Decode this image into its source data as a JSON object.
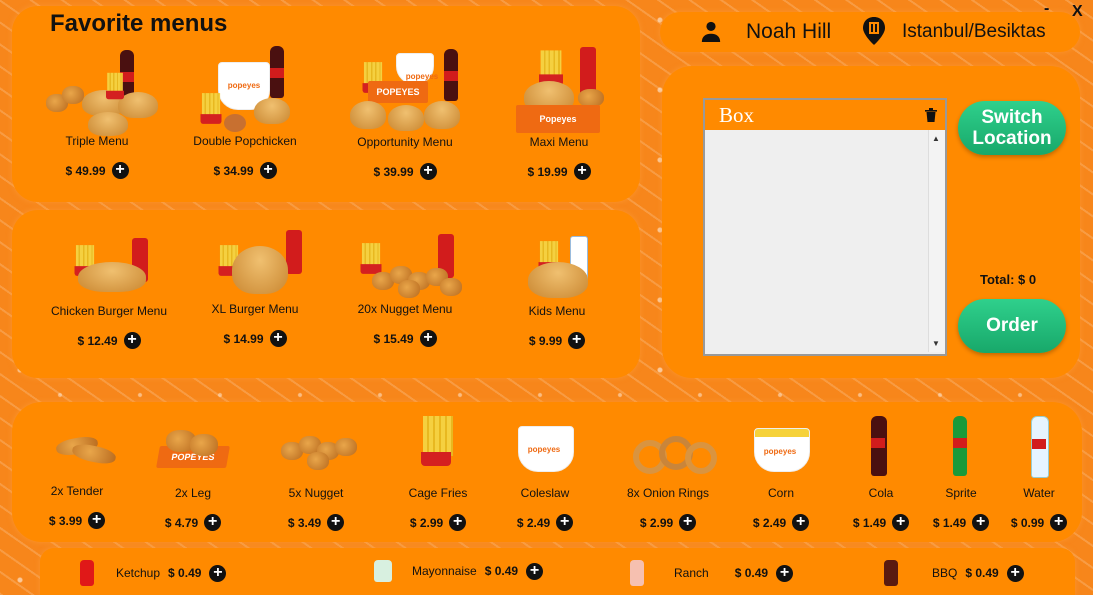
{
  "window": {
    "minimize_label": "-",
    "close_label": "X"
  },
  "favorites": {
    "title": "Favorite menus",
    "items": [
      {
        "name": "Triple Menu",
        "price": "$ 49.99"
      },
      {
        "name": "Double Popchicken",
        "price": "$ 34.99"
      },
      {
        "name": "Opportunity Menu",
        "price": "$ 39.99"
      },
      {
        "name": "Maxi Menu",
        "price": "$ 19.99"
      },
      {
        "name": "Chicken Burger Menu",
        "price": "$ 12.49"
      },
      {
        "name": "XL Burger Menu",
        "price": "$ 14.99"
      },
      {
        "name": "20x Nugget Menu",
        "price": "$ 15.49"
      },
      {
        "name": "Kids Menu",
        "price": "$ 9.99"
      }
    ]
  },
  "user": {
    "name": "Noah Hill",
    "location": "Istanbul/Besiktas"
  },
  "cart": {
    "header": "Box",
    "total_label": "Total: $ 0",
    "switch_label": "Switch Location",
    "order_label": "Order"
  },
  "sides": [
    {
      "name": "2x Tender",
      "price": "$ 3.99"
    },
    {
      "name": "2x Leg",
      "price": "$ 4.79"
    },
    {
      "name": "5x Nugget",
      "price": "$ 3.49"
    },
    {
      "name": "Cage Fries",
      "price": "$ 2.99"
    },
    {
      "name": "Coleslaw",
      "price": "$ 2.49"
    },
    {
      "name": "8x Onion Rings",
      "price": "$ 2.99"
    },
    {
      "name": "Corn",
      "price": "$ 2.49"
    },
    {
      "name": "Cola",
      "price": "$ 1.49"
    },
    {
      "name": "Sprite",
      "price": "$ 1.49"
    },
    {
      "name": "Water",
      "price": "$ 0.99"
    }
  ],
  "sauces": [
    {
      "name": "Ketchup",
      "price": "$ 0.49"
    },
    {
      "name": "Mayonnaise",
      "price": "$ 0.49"
    },
    {
      "name": "Ranch",
      "price": "$ 0.49"
    },
    {
      "name": "BBQ",
      "price": "$ 0.49"
    }
  ],
  "icons": {
    "add": "+",
    "user": "person-icon",
    "location": "location-pin-icon",
    "trash": "trash-icon"
  },
  "colors": {
    "accent": "#ff8a00",
    "button": "#22c17d"
  }
}
